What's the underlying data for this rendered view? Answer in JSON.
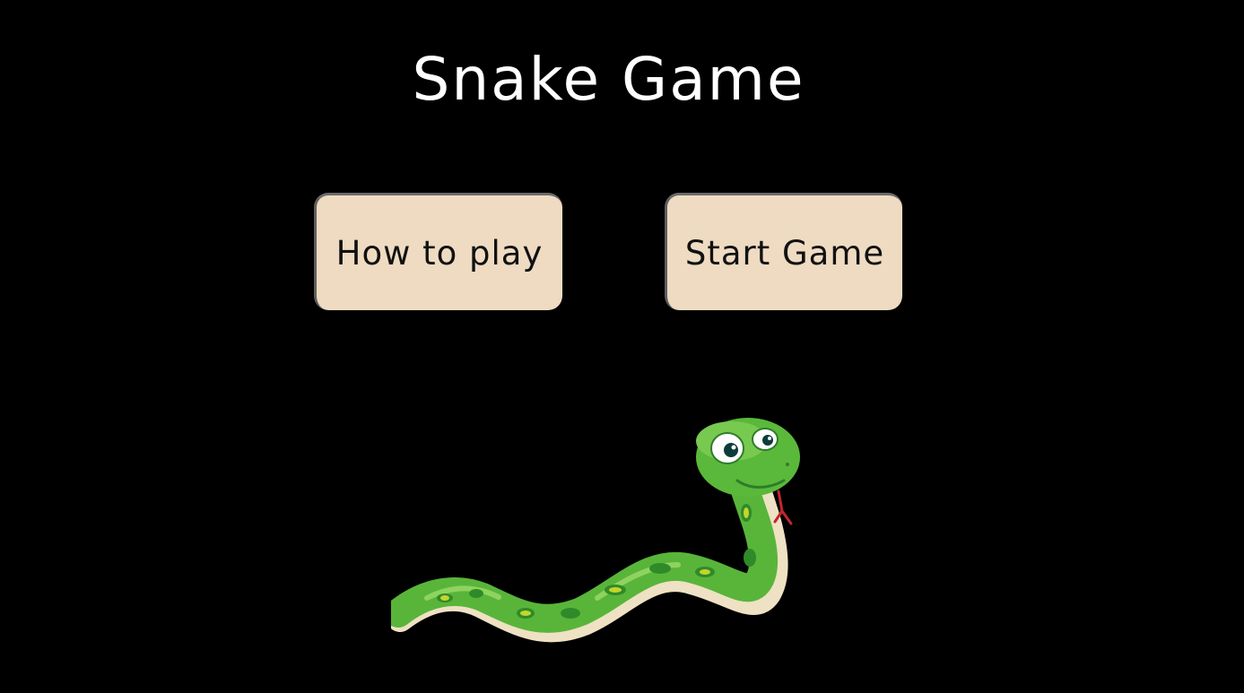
{
  "header": {
    "title": "Snake Game"
  },
  "menu": {
    "how_to_play_label": "How to play",
    "start_game_label": "Start Game"
  },
  "mascot": {
    "icon": "snake-illustration"
  },
  "colors": {
    "background": "#000000",
    "title": "#ffffff",
    "button_bg": "#eedbc2",
    "button_text": "#111111",
    "snake_green": "#58b53a",
    "snake_belly": "#efe1c3"
  }
}
